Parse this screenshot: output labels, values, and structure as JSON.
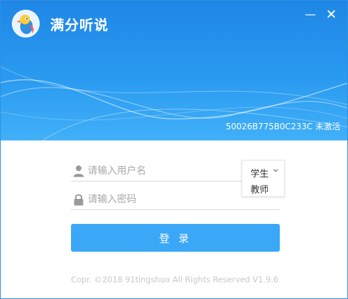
{
  "window": {
    "title": "满分听说",
    "minimize_symbol": "—",
    "close_symbol": "✕"
  },
  "header": {
    "device_status": "50026B775B0C233C 未激活"
  },
  "form": {
    "username": {
      "placeholder": "请输入用户名",
      "value": ""
    },
    "password": {
      "placeholder": "请输入密码",
      "value": ""
    },
    "role": {
      "selected": "学生",
      "options": [
        "学生",
        "教师"
      ]
    },
    "login_label": "登 录"
  },
  "footer": {
    "copyright": "Copr. ©2018 91tingshuo All Rights Reserved V1.9.6"
  },
  "colors": {
    "header_top": "#1f87e6",
    "header_bottom": "#41b0f8",
    "login_button": "#3aa7f7"
  },
  "icons": {
    "logo": "parrot-mascot-icon",
    "username": "user-icon",
    "password": "lock-icon",
    "role": "chevron-down-icon"
  }
}
